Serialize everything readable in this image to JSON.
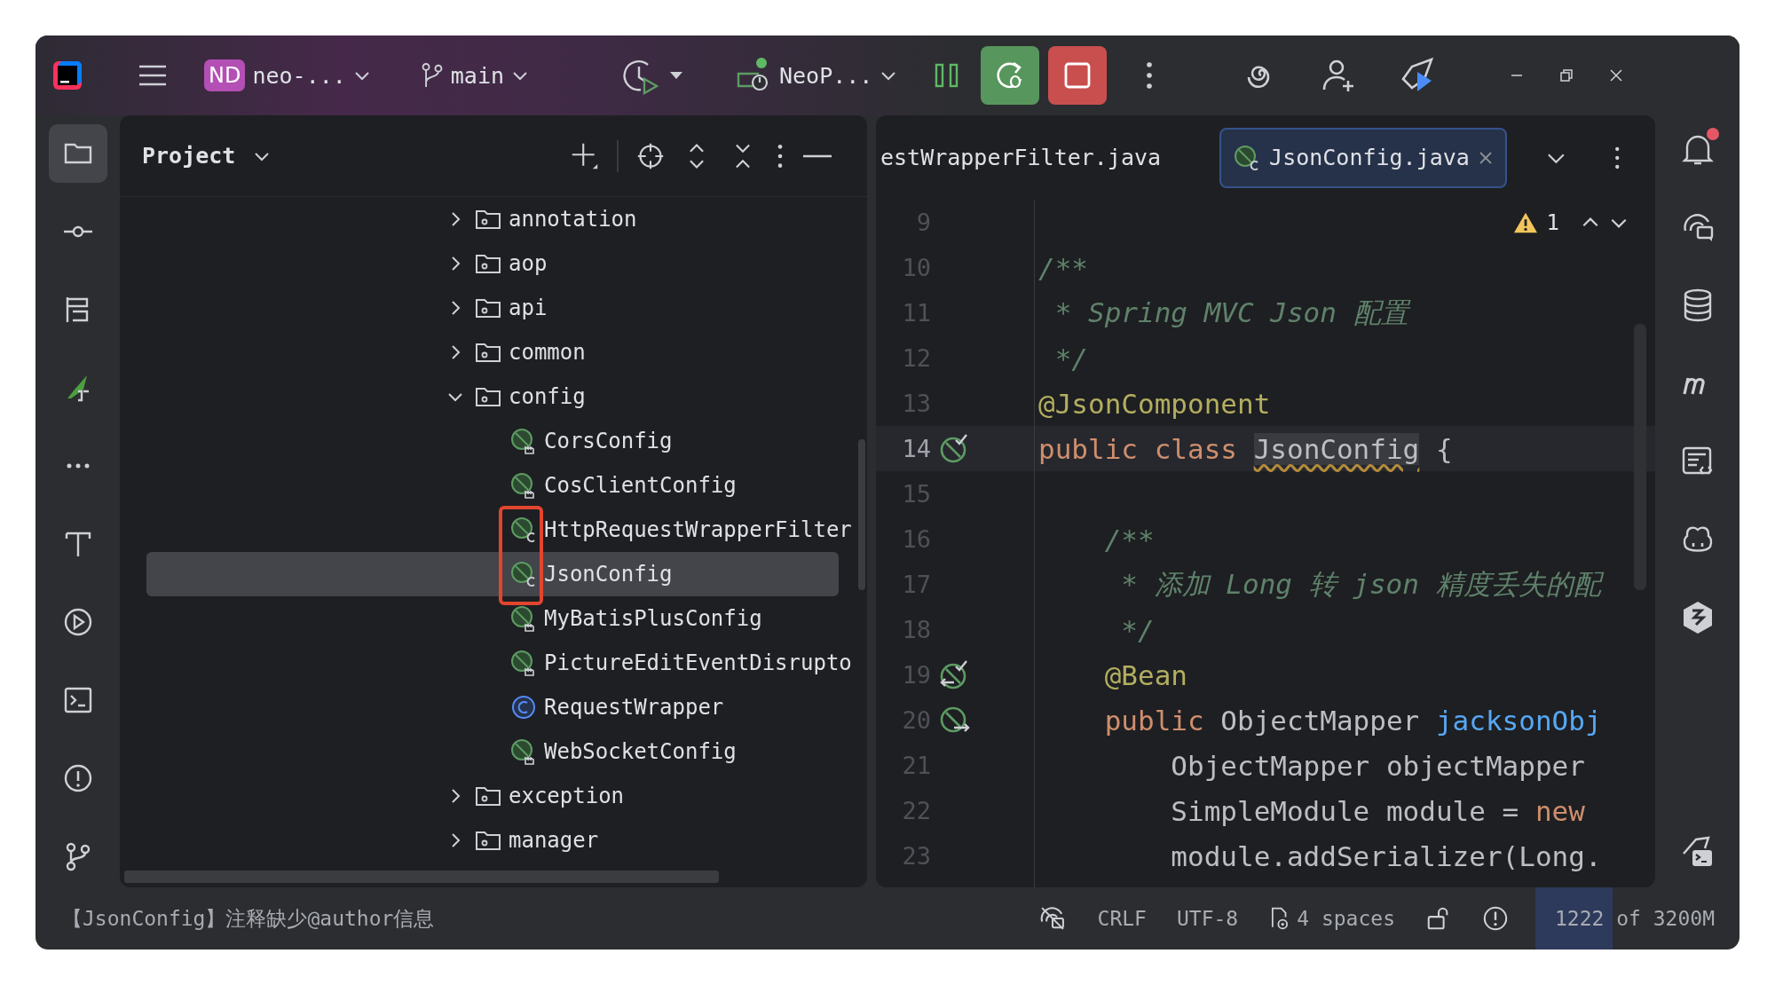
{
  "title_bar": {
    "project_initials": "ND",
    "project": "neo-...",
    "branch": "main",
    "run_configuration": "NeoP..."
  },
  "left_tools": [
    {
      "selected": true
    },
    {
      "selected": false
    },
    {
      "selected": false
    },
    {
      "selected": false
    },
    {
      "selected": false
    },
    {
      "selected": false
    },
    {
      "selected": false
    },
    {
      "selected": false
    },
    {
      "selected": false
    },
    {
      "selected": false
    }
  ],
  "project_panel": {
    "title": "Project",
    "tree": [
      {
        "label": "annotation",
        "kind": "folder",
        "expanded": false
      },
      {
        "label": "aop",
        "kind": "folder",
        "expanded": false
      },
      {
        "label": "api",
        "kind": "folder",
        "expanded": false
      },
      {
        "label": "common",
        "kind": "folder",
        "expanded": false
      },
      {
        "label": "config",
        "kind": "folder",
        "expanded": true,
        "children": [
          {
            "label": "CorsConfig",
            "kind": "spring-config",
            "selected": false
          },
          {
            "label": "CosClientConfig",
            "kind": "spring-config",
            "selected": false
          },
          {
            "label": "HttpRequestWrapperFilter",
            "kind": "spring-component",
            "selected": false
          },
          {
            "label": "JsonConfig",
            "kind": "spring-component",
            "selected": true
          },
          {
            "label": "MyBatisPlusConfig",
            "kind": "spring-config",
            "selected": false
          },
          {
            "label": "PictureEditEventDisrupto",
            "kind": "spring-config",
            "selected": false
          },
          {
            "label": "RequestWrapper",
            "kind": "class",
            "selected": false
          },
          {
            "label": "WebSocketConfig",
            "kind": "spring-config",
            "selected": false
          }
        ]
      },
      {
        "label": "exception",
        "kind": "folder",
        "expanded": false
      },
      {
        "label": "manager",
        "kind": "folder",
        "expanded": false
      }
    ]
  },
  "editor": {
    "tabs": [
      {
        "label": "estWrapperFilter.java",
        "selected": false
      },
      {
        "label": "JsonConfig.java",
        "selected": true
      }
    ],
    "warnings": "1",
    "lines": [
      {
        "number": "9",
        "current": false
      },
      {
        "number": "10",
        "current": false,
        "tokens": [
          {
            "kind": "comment",
            "text": "/**"
          }
        ]
      },
      {
        "number": "11",
        "current": false,
        "tokens": [
          {
            "kind": "comment",
            "text": " * Spring MVC Json 配置"
          }
        ]
      },
      {
        "number": "12",
        "current": false,
        "tokens": [
          {
            "kind": "comment",
            "text": " */"
          }
        ]
      },
      {
        "number": "13",
        "current": false,
        "tokens": [
          {
            "kind": "annotation",
            "text": "@JsonComponent"
          }
        ]
      },
      {
        "number": "14",
        "current": true,
        "gutter": {
          "kind": "bean"
        },
        "tokens": [
          {
            "kind": "keyword",
            "text": "public class "
          },
          {
            "kind": "flagged",
            "text": "JsonConfig"
          },
          {
            "kind": "plain",
            "text": " {"
          }
        ]
      },
      {
        "number": "15",
        "current": false
      },
      {
        "number": "16",
        "current": false,
        "tokens": [
          {
            "kind": "comment",
            "text": "    /**"
          }
        ]
      },
      {
        "number": "17",
        "current": false,
        "tokens": [
          {
            "kind": "comment",
            "text": "     * 添加 Long 转 json 精度丢失的配"
          }
        ]
      },
      {
        "number": "18",
        "current": false,
        "tokens": [
          {
            "kind": "comment",
            "text": "     */"
          }
        ]
      },
      {
        "number": "19",
        "current": false,
        "gutter": {
          "kind": "bean-usages"
        },
        "tokens": [
          {
            "kind": "annotation",
            "text": "    @Bean"
          }
        ]
      },
      {
        "number": "20",
        "current": false,
        "gutter": {
          "kind": "bean-inject"
        },
        "tokens": [
          {
            "kind": "keyword",
            "text": "    public "
          },
          {
            "kind": "plain",
            "text": "ObjectMapper "
          },
          {
            "kind": "method",
            "text": "jacksonObj"
          }
        ]
      },
      {
        "number": "21",
        "current": false,
        "tokens": [
          {
            "kind": "plain",
            "text": "        ObjectMapper objectMapper"
          }
        ]
      },
      {
        "number": "22",
        "current": false,
        "tokens": [
          {
            "kind": "plain",
            "text": "        SimpleModule module = "
          },
          {
            "kind": "keyword",
            "text": "new"
          }
        ]
      },
      {
        "number": "23",
        "current": false,
        "tokens": [
          {
            "kind": "plain",
            "text": "        module.addSerializer(Long."
          }
        ]
      }
    ]
  },
  "notifications": {
    "unread": true
  },
  "status_bar": {
    "message": "【JsonConfig】注释缺少@author信息",
    "line_separator": "CRLF",
    "encoding": "UTF-8",
    "indent": "4 spaces",
    "memory": {
      "text": "1222 of 3200M",
      "level": 0.38
    }
  }
}
